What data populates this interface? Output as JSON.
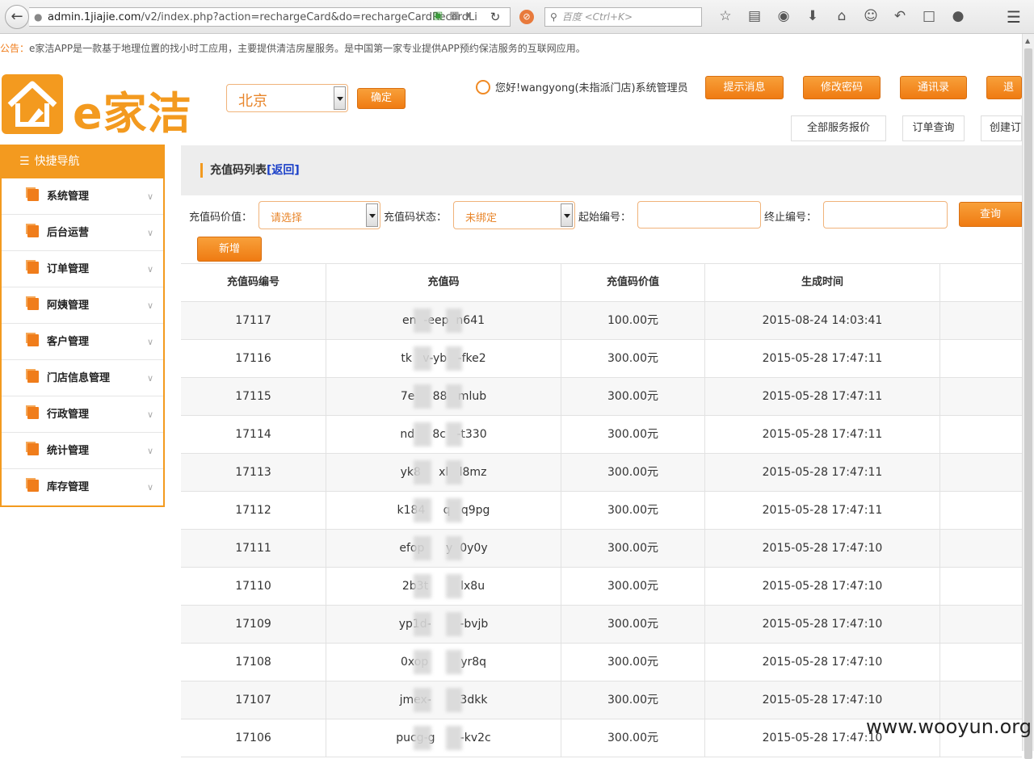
{
  "browser": {
    "url_host": "admin.1jiajie.com",
    "url_path": "/v2/index.php?action=rechargeCard&do=rechargeCardRecordLi",
    "search_placeholder": "百度 <Ctrl+K>",
    "icons": [
      "star-icon",
      "reading-list-icon",
      "pocket-icon",
      "download-icon",
      "home-icon",
      "chat-icon",
      "undo-icon",
      "crop-icon",
      "speech-icon"
    ]
  },
  "notice": {
    "label": "公告：",
    "text": "e家洁APP是一款基于地理位置的找小时工应用，主要提供清洁房屋服务。是中国第一家专业提供APP预约保洁服务的互联网应用。"
  },
  "header": {
    "logo_text": "e家洁",
    "city": "北京",
    "confirm_label": "确定",
    "greeting": "您好!wangyong(未指派门店)系统管理员",
    "top_buttons": [
      "提示消息",
      "修改密码",
      "通讯录",
      "退出"
    ],
    "sub_buttons": [
      "全部服务报价",
      "订单查询",
      "创建订单"
    ]
  },
  "sidebar": {
    "title": "快捷导航",
    "items": [
      "系统管理",
      "后台运营",
      "订单管理",
      "阿姨管理",
      "客户管理",
      "门店信息管理",
      "行政管理",
      "统计管理",
      "库存管理"
    ]
  },
  "main": {
    "title": "充值码列表",
    "back_link": "[返回]",
    "filter": {
      "value_label": "充值码价值：",
      "value_select": "请选择",
      "status_label": "充值码状态：",
      "status_select": "未绑定",
      "start_label": "起始编号：",
      "end_label": "终止编号：",
      "query_label": "查询",
      "add_label": "新增"
    },
    "columns": [
      "充值码编号",
      "充值码",
      "充值码价值",
      "生成时间",
      ""
    ],
    "rows": [
      {
        "id": "17117",
        "code": "en  -eep  n641",
        "value": "100.00元",
        "time": "2015-08-24 14:03:41"
      },
      {
        "id": "17116",
        "code": "tk   v-yb   -fke2",
        "value": "300.00元",
        "time": "2015-05-28 17:47:11"
      },
      {
        "id": "17115",
        "code": "7e     88   mlub",
        "value": "300.00元",
        "time": "2015-05-28 17:47:11"
      },
      {
        "id": "17114",
        "code": "nd     8c   -t330",
        "value": "300.00元",
        "time": "2015-05-28 17:47:11"
      },
      {
        "id": "17113",
        "code": "yk8     xl   l8mz",
        "value": "300.00元",
        "time": "2015-05-28 17:47:11"
      },
      {
        "id": "17112",
        "code": "k184     q   q9pg",
        "value": "300.00元",
        "time": "2015-05-28 17:47:11"
      },
      {
        "id": "17111",
        "code": "efop      y  0y0y",
        "value": "300.00元",
        "time": "2015-05-28 17:47:10"
      },
      {
        "id": "17110",
        "code": "2b3t         lx8u",
        "value": "300.00元",
        "time": "2015-05-28 17:47:10"
      },
      {
        "id": "17109",
        "code": "yp1d-        -bvjb",
        "value": "300.00元",
        "time": "2015-05-28 17:47:10"
      },
      {
        "id": "17108",
        "code": "0xop         yr8q",
        "value": "300.00元",
        "time": "2015-05-28 17:47:10"
      },
      {
        "id": "17107",
        "code": "jmex-        3dkk",
        "value": "300.00元",
        "time": "2015-05-28 17:47:10"
      },
      {
        "id": "17106",
        "code": "pucg-g       -kv2c",
        "value": "300.00元",
        "time": "2015-05-28 17:47:10"
      }
    ]
  },
  "watermark": "www.wooyun.org",
  "colors": {
    "accent": "#f39a1f",
    "button": "#ef7b12",
    "link": "#1a3fc8"
  }
}
